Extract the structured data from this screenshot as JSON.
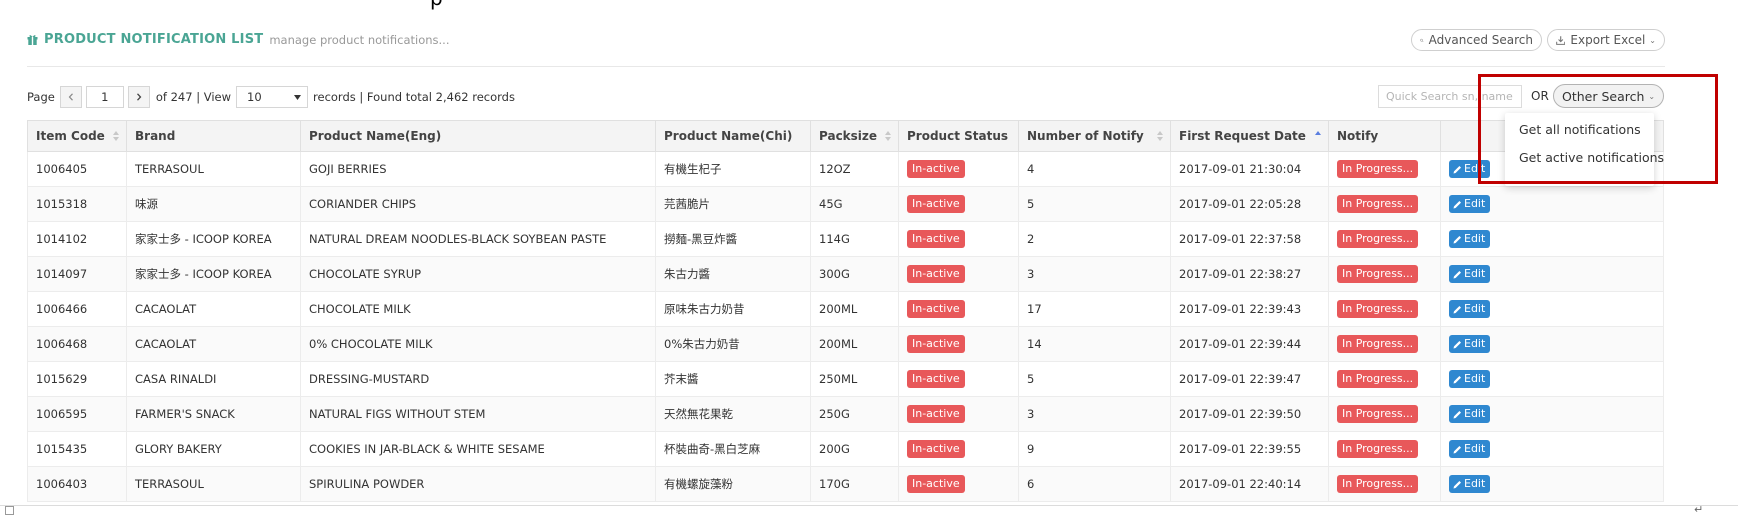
{
  "header": {
    "title": "PRODUCT NOTIFICATION LIST",
    "subtitle": "manage product notifications...",
    "advanced_search_label": "Advanced Search",
    "export_excel_label": "Export Excel"
  },
  "paging": {
    "page_label": "Page",
    "current_page": "1",
    "of_text": "of 247 | View",
    "view_value": "10",
    "records_text": "records | Found total 2,462 records"
  },
  "search": {
    "quick_placeholder": "Quick Search sn, name",
    "or_label": "OR",
    "other_search_label": "Other Search"
  },
  "dropdown": {
    "items": [
      "Get all notifications",
      "Get active notifications"
    ]
  },
  "table": {
    "columns": [
      "Item Code",
      "Brand",
      "Product Name(Eng)",
      "Product Name(Chi)",
      "Packsize",
      "Product Status",
      "Number of Notify",
      "First Request Date",
      "Notify",
      ""
    ],
    "rows": [
      {
        "item_code": "1006405",
        "brand": "TERRASOUL",
        "name_eng": "GOJI BERRIES",
        "name_chi": "有機生杞子",
        "packsize": "12OZ",
        "status": "In-active",
        "notify_count": "4",
        "first_request": "2017-09-01 21:30:04",
        "notify_status": "In Progress...",
        "action": "Edit"
      },
      {
        "item_code": "1015318",
        "brand": "味源",
        "name_eng": "CORIANDER CHIPS",
        "name_chi": "芫茜脆片",
        "packsize": "45G",
        "status": "In-active",
        "notify_count": "5",
        "first_request": "2017-09-01 22:05:28",
        "notify_status": "In Progress...",
        "action": "Edit"
      },
      {
        "item_code": "1014102",
        "brand": "家家士多 - ICOOP KOREA",
        "name_eng": "NATURAL DREAM NOODLES-BLACK SOYBEAN PASTE",
        "name_chi": "撈麵-黑豆炸醬",
        "packsize": "114G",
        "status": "In-active",
        "notify_count": "2",
        "first_request": "2017-09-01 22:37:58",
        "notify_status": "In Progress...",
        "action": "Edit"
      },
      {
        "item_code": "1014097",
        "brand": "家家士多 - ICOOP KOREA",
        "name_eng": "CHOCOLATE SYRUP",
        "name_chi": "朱古力醬",
        "packsize": "300G",
        "status": "In-active",
        "notify_count": "3",
        "first_request": "2017-09-01 22:38:27",
        "notify_status": "In Progress...",
        "action": "Edit"
      },
      {
        "item_code": "1006466",
        "brand": "CACAOLAT",
        "name_eng": "CHOCOLATE MILK",
        "name_chi": "原味朱古力奶昔",
        "packsize": "200ML",
        "status": "In-active",
        "notify_count": "17",
        "first_request": "2017-09-01 22:39:43",
        "notify_status": "In Progress...",
        "action": "Edit"
      },
      {
        "item_code": "1006468",
        "brand": "CACAOLAT",
        "name_eng": "0% CHOCOLATE MILK",
        "name_chi": "0%朱古力奶昔",
        "packsize": "200ML",
        "status": "In-active",
        "notify_count": "14",
        "first_request": "2017-09-01 22:39:44",
        "notify_status": "In Progress...",
        "action": "Edit"
      },
      {
        "item_code": "1015629",
        "brand": "CASA RINALDI",
        "name_eng": "DRESSING-MUSTARD",
        "name_chi": "芥末醬",
        "packsize": "250ML",
        "status": "In-active",
        "notify_count": "5",
        "first_request": "2017-09-01 22:39:47",
        "notify_status": "In Progress...",
        "action": "Edit"
      },
      {
        "item_code": "1006595",
        "brand": "FARMER'S SNACK",
        "name_eng": "NATURAL FIGS WITHOUT STEM",
        "name_chi": "天然無花果乾",
        "packsize": "250G",
        "status": "In-active",
        "notify_count": "3",
        "first_request": "2017-09-01 22:39:50",
        "notify_status": "In Progress...",
        "action": "Edit"
      },
      {
        "item_code": "1015435",
        "brand": "GLORY BAKERY",
        "name_eng": "COOKIES IN JAR-BLACK & WHITE SESAME",
        "name_chi": "杯裝曲奇-黑白芝麻",
        "packsize": "200G",
        "status": "In-active",
        "notify_count": "9",
        "first_request": "2017-09-01 22:39:55",
        "notify_status": "In Progress...",
        "action": "Edit"
      },
      {
        "item_code": "1006403",
        "brand": "TERRASOUL",
        "name_eng": "SPIRULINA POWDER",
        "name_chi": "有機螺旋藻粉",
        "packsize": "170G",
        "status": "In-active",
        "notify_count": "6",
        "first_request": "2017-09-01 22:40:14",
        "notify_status": "In Progress...",
        "action": "Edit"
      }
    ]
  },
  "colors": {
    "accent": "#4aa594",
    "badge_red": "#e8585a",
    "edit_blue": "#2f88d0",
    "highlight": "#c00000"
  },
  "icons": [
    "gift-icon",
    "search-icon",
    "download-icon",
    "chevron-down-icon",
    "chevron-left-icon",
    "chevron-right-icon",
    "sort-icon",
    "pencil-icon"
  ]
}
